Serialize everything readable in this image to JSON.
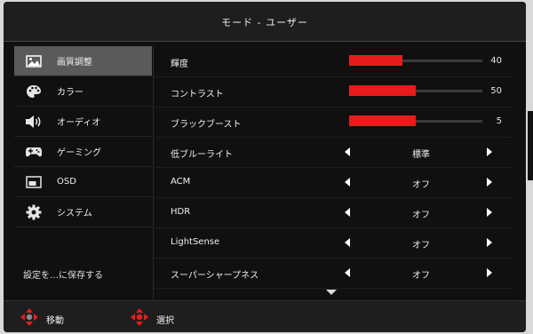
{
  "title": "モード - ユーザー",
  "sidebar": {
    "items": [
      {
        "label": "画質調整",
        "icon": "picture-icon",
        "selected": true
      },
      {
        "label": "カラー",
        "icon": "palette-icon",
        "selected": false
      },
      {
        "label": "オーディオ",
        "icon": "speaker-icon",
        "selected": false
      },
      {
        "label": "ゲーミング",
        "icon": "gamepad-icon",
        "selected": false
      },
      {
        "label": "OSD",
        "icon": "osd-icon",
        "selected": false
      },
      {
        "label": "システム",
        "icon": "gear-icon",
        "selected": false
      }
    ],
    "save_label": "設定を…に保存する"
  },
  "main": {
    "sliders": [
      {
        "label": "輝度",
        "value": "40",
        "level": 0.4
      },
      {
        "label": "コントラスト",
        "value": "50",
        "level": 0.5
      },
      {
        "label": "ブラックブースト",
        "value": "5",
        "level": 0.5
      }
    ],
    "options": [
      {
        "label": "低ブルーライト",
        "value": "標準"
      },
      {
        "label": "ACM",
        "value": "オフ"
      },
      {
        "label": "HDR",
        "value": "オフ"
      },
      {
        "label": "LightSense",
        "value": "オフ"
      },
      {
        "label": "スーパーシャープネス",
        "value": "オフ"
      }
    ]
  },
  "footer": {
    "move_label": "移動",
    "select_label": "選択"
  },
  "colors": {
    "accent": "#e81c1c",
    "background": "#101010",
    "selected": "#5a5a5a"
  }
}
